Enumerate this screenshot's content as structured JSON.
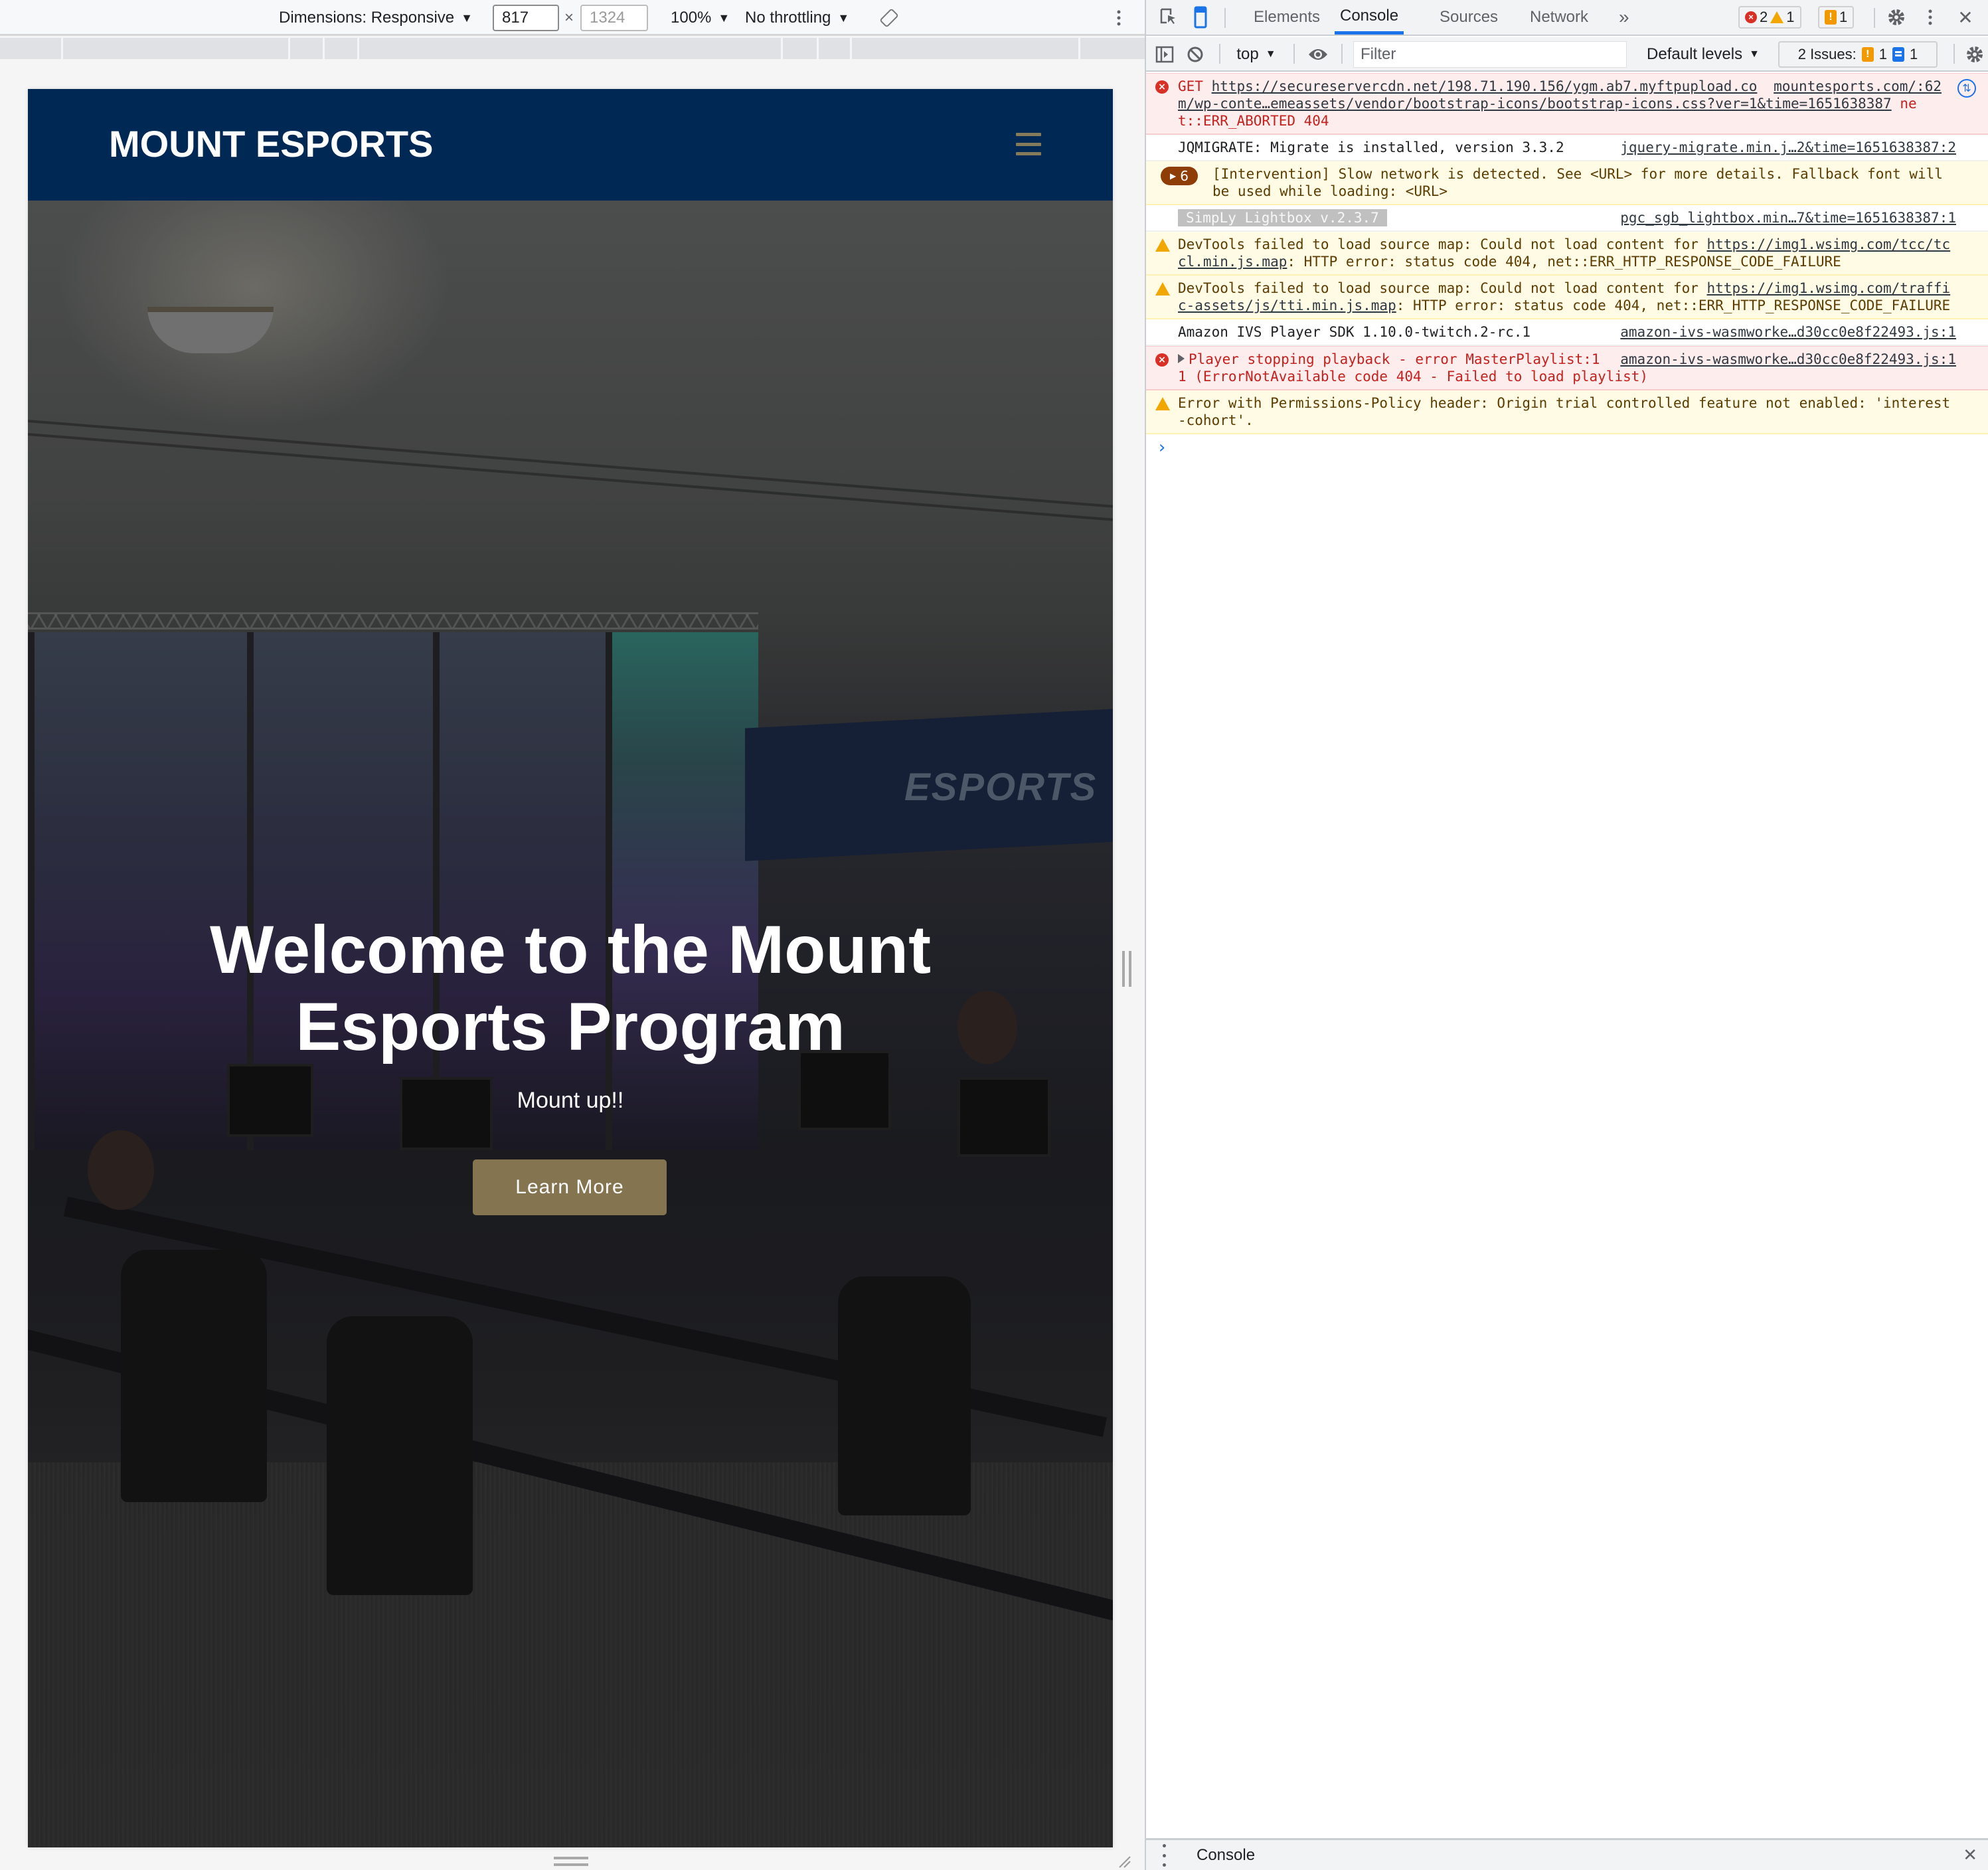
{
  "device_toolbar": {
    "dimensions_label": "Dimensions: Responsive",
    "width_value": "817",
    "times_sign": "×",
    "height_placeholder": "1324",
    "zoom_label": "100%",
    "throttling_label": "No throttling"
  },
  "site": {
    "logo": "MOUNT ESPORTS",
    "hero_title_line1": "Welcome to the Mount",
    "hero_title_line2": "Esports Program",
    "hero_subtitle": "Mount up!!",
    "cta_label": "Learn More",
    "banner_text": "ESPORTS",
    "colors": {
      "header_bg": "#002855",
      "cta_bg": "#857450",
      "hamburger": "#857a5a"
    }
  },
  "devtools": {
    "tabs": [
      {
        "label": "Elements",
        "active": false
      },
      {
        "label": "Console",
        "active": true
      },
      {
        "label": "Sources",
        "active": false
      },
      {
        "label": "Network",
        "active": false
      }
    ],
    "more_tabs": "»",
    "counts": {
      "errors": "2",
      "warnings": "1",
      "issues": "1"
    },
    "console_toolbar": {
      "context": "top",
      "filter_placeholder": "Filter",
      "levels_label": "Default levels",
      "issues_label": "2 Issues:",
      "issues_warn_count": "1",
      "issues_info_count": "1"
    },
    "messages": [
      {
        "level": "error",
        "prefix": "GET ",
        "url": "https://secureservercdn.net/198.71.190.156/ygm.ab7.myftpupload.com/wp-conte…emeassets/vendor/bootstrap-icons/bootstrap-icons.css?ver=1&time=1651638387",
        "suffix": " net::ERR_ABORTED 404",
        "source": "mountesports.com/:62"
      },
      {
        "level": "info",
        "text": "JQMIGRATE: Migrate is installed, version 3.3.2",
        "source": "jquery-migrate.min.j…2&time=1651638387:2"
      },
      {
        "level": "warn-group",
        "count": "6",
        "text": "[Intervention] Slow network is detected. See <URL> for more details. Fallback font will be used while loading: <URL>"
      },
      {
        "level": "info",
        "styled_text": "SimpLy Lightbox v.2.3.7",
        "source": "pgc_sgb_lightbox.min…7&time=1651638387:1"
      },
      {
        "level": "warn",
        "prefix": "DevTools failed to load source map: Could not load content for ",
        "url": "https://img1.wsimg.com/tcc/tccl.min.js.map",
        "suffix": ": HTTP error: status code 404, net::ERR_HTTP_RESPONSE_CODE_FAILURE"
      },
      {
        "level": "warn",
        "prefix": "DevTools failed to load source map: Could not load content for ",
        "url": "https://img1.wsimg.com/traffic-assets/js/tti.min.js.map",
        "suffix": ": HTTP error: status code 404, net::ERR_HTTP_RESPONSE_CODE_FAILURE"
      },
      {
        "level": "info",
        "text": "Amazon IVS Player SDK 1.10.0-twitch.2-rc.1",
        "source": "amazon-ivs-wasmworke…d30cc0e8f22493.js:1"
      },
      {
        "level": "error",
        "text": "Player stopping playback - error MasterPlaylist:11 (ErrorNotAvailable code 404 - Failed to load playlist)",
        "source": "amazon-ivs-wasmworke…d30cc0e8f22493.js:1"
      },
      {
        "level": "warn",
        "text": "Error with Permissions-Policy header: Origin trial controlled feature not enabled: 'interest-cohort'."
      }
    ],
    "prompt": "›",
    "drawer_title": "Console",
    "drawer_close": "✕"
  }
}
